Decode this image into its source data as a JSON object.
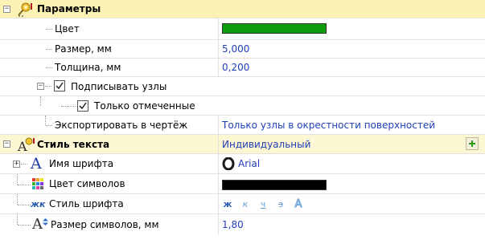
{
  "groups": {
    "params": {
      "title": "Параметры",
      "toggle": "−",
      "rows": {
        "color": {
          "label": "Цвет",
          "swatch": "#0c9c0c"
        },
        "size": {
          "label": "Размер, мм",
          "value": "5,000"
        },
        "thickness": {
          "label": "Толщина, мм",
          "value": "0,200"
        },
        "sign_nodes": {
          "label": "Подписывать узлы",
          "checked": true,
          "toggle": "−"
        },
        "only_marked": {
          "label": "Только отмеченные",
          "checked": true
        },
        "export": {
          "label": "Экспортировать в чертёж",
          "value": "Только узлы в окрестности поверхностей"
        }
      }
    },
    "text_style": {
      "title": "Стиль текста",
      "value": "Индивидуальный",
      "toggle": "−",
      "rows": {
        "font_name": {
          "label": "Имя шрифта",
          "value": "Arial",
          "toggle": "+",
          "icon_glyph": "A"
        },
        "symbol_color": {
          "label": "Цвет символов",
          "swatch": "#000000"
        },
        "font_style": {
          "label": "Стиль шрифта",
          "icon_text": "жк",
          "buttons": [
            {
              "name": "bold",
              "glyph": "ж"
            },
            {
              "name": "italic",
              "glyph": "к"
            },
            {
              "name": "underline",
              "glyph": "ч"
            },
            {
              "name": "strike",
              "glyph": "з"
            },
            {
              "name": "outline",
              "glyph": "A"
            }
          ]
        },
        "symbol_size": {
          "label": "Размер символов, мм",
          "value": "1,80",
          "icon_glyph": "A"
        }
      }
    }
  },
  "colors": {
    "value_text": "#1f3fb8",
    "selected_group": "#fdf1b4",
    "group_bg": "#fffbe6"
  }
}
